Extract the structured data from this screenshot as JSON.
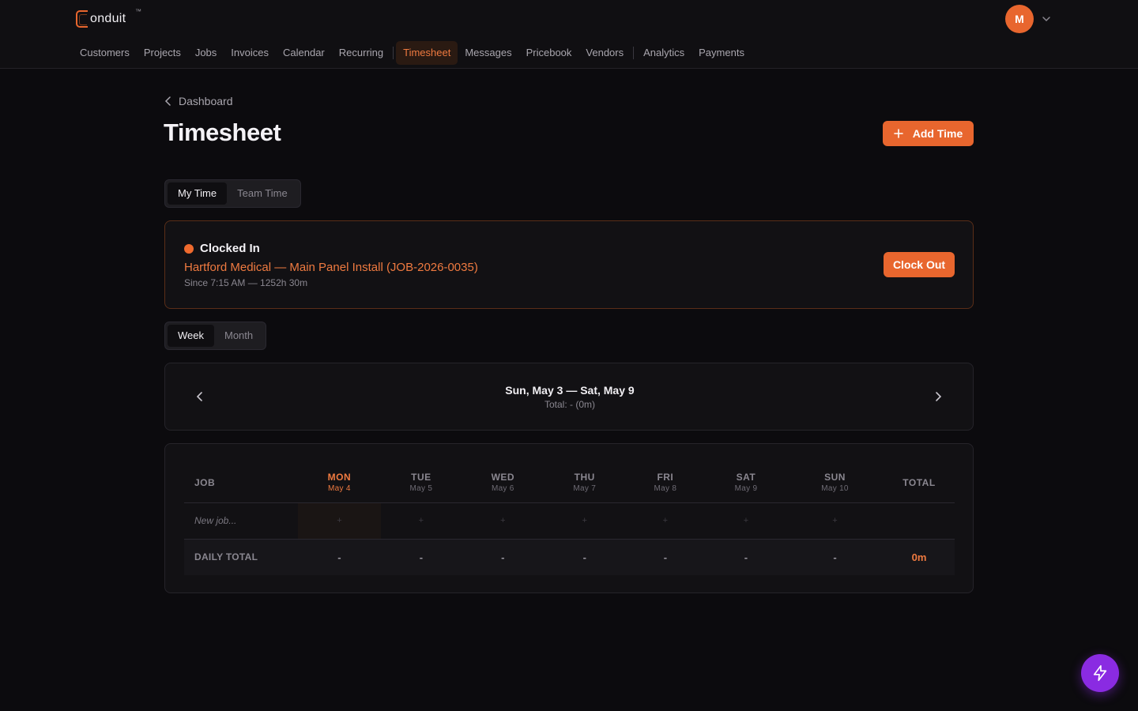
{
  "brand": {
    "name": "onduit",
    "tm": "™"
  },
  "user": {
    "initial": "M"
  },
  "nav": {
    "items": [
      {
        "label": "Customers"
      },
      {
        "label": "Projects"
      },
      {
        "label": "Jobs"
      },
      {
        "label": "Invoices"
      },
      {
        "label": "Calendar"
      },
      {
        "label": "Recurring"
      },
      {
        "label": "Timesheet"
      },
      {
        "label": "Messages"
      },
      {
        "label": "Pricebook"
      },
      {
        "label": "Vendors"
      },
      {
        "label": "Analytics"
      },
      {
        "label": "Payments"
      }
    ],
    "active": "Timesheet"
  },
  "breadcrumb": {
    "label": "Dashboard"
  },
  "page": {
    "title": "Timesheet",
    "add_label": "Add Time"
  },
  "view_toggle": {
    "options": [
      "My Time",
      "Team Time"
    ],
    "selected": "My Time"
  },
  "clock": {
    "status": "Clocked In",
    "job": "Hartford Medical — Main Panel Install (JOB-2026-0035)",
    "since": "Since 7:15 AM — 1252h 30m",
    "button": "Clock Out"
  },
  "range_toggle": {
    "options": [
      "Week",
      "Month"
    ],
    "selected": "Week"
  },
  "week": {
    "range": "Sun, May 3 — Sat, May 9",
    "total": "Total: - (0m)"
  },
  "grid": {
    "job_header": "JOB",
    "total_header": "TOTAL",
    "days": [
      {
        "name": "MON",
        "date": "May 4"
      },
      {
        "name": "TUE",
        "date": "May 5"
      },
      {
        "name": "WED",
        "date": "May 6"
      },
      {
        "name": "THU",
        "date": "May 7"
      },
      {
        "name": "FRI",
        "date": "May 8"
      },
      {
        "name": "SAT",
        "date": "May 9"
      },
      {
        "name": "SUN",
        "date": "May 10"
      }
    ],
    "today_index": 0,
    "new_job_placeholder": "New job...",
    "cell_placeholder": "+",
    "daily_total_label": "DAILY TOTAL",
    "daily_totals": [
      "-",
      "-",
      "-",
      "-",
      "-",
      "-",
      "-"
    ],
    "grand_total": "0m"
  },
  "colors": {
    "accent": "#e8662e",
    "fab": "#8a2be2",
    "background": "#0c0b0e"
  },
  "icons": {
    "back": "chevron-left-icon",
    "add": "plus-icon",
    "caret": "chevron-down-icon",
    "prev": "chevron-left-icon",
    "next": "chevron-right-icon",
    "fab": "lightning-icon"
  }
}
